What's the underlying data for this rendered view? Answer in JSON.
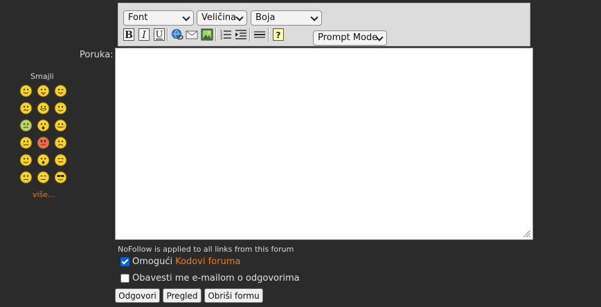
{
  "toolbar": {
    "font_select": "Font",
    "size_select": "Veličina",
    "color_select": "Boja",
    "prompt_mode_select": "Prompt Mode",
    "buttons": [
      {
        "name": "bold-button",
        "icon": "bold-icon"
      },
      {
        "name": "italic-button",
        "icon": "italic-icon"
      },
      {
        "name": "underline-button",
        "icon": "underline-icon"
      },
      {
        "name": "insert-link-button",
        "icon": "globe-link-icon"
      },
      {
        "name": "insert-email-button",
        "icon": "envelope-icon"
      },
      {
        "name": "insert-image-button",
        "icon": "image-icon"
      },
      {
        "name": "numbered-list-button",
        "icon": "numbered-list-icon"
      },
      {
        "name": "indent-button",
        "icon": "indent-icon"
      },
      {
        "name": "horizontal-rule-button",
        "icon": "horizontal-rule-icon"
      },
      {
        "name": "help-button",
        "icon": "help-icon"
      }
    ]
  },
  "form": {
    "message_label": "Poruka:",
    "message_value": ""
  },
  "smilies": {
    "title": "Smajli",
    "items": [
      "smile",
      "tongue",
      "wink",
      "confused",
      "grin",
      "cool",
      "sick",
      "shocked",
      "blush",
      "cry",
      "angry",
      "sad",
      "star",
      "surprised",
      "sleepy",
      "frown",
      "neutral",
      "sunglasses"
    ],
    "more_label": "više..."
  },
  "notice": "NoFollow is applied to all links from this forum",
  "options": {
    "enable_codes_prefix": "Omogući",
    "enable_codes_link": "Kodovi foruma",
    "enable_codes_checked": true,
    "notify_email_label": "Obavesti me e-mailom o odgovorima",
    "notify_email_checked": false
  },
  "actions": {
    "reply": "Odgovori",
    "preview": "Pregled",
    "clear": "Obriši formu"
  },
  "colors": {
    "background": "#2b2b2b",
    "accent_link": "#f07a1c",
    "checkbox_checked": "#0a63d6"
  }
}
